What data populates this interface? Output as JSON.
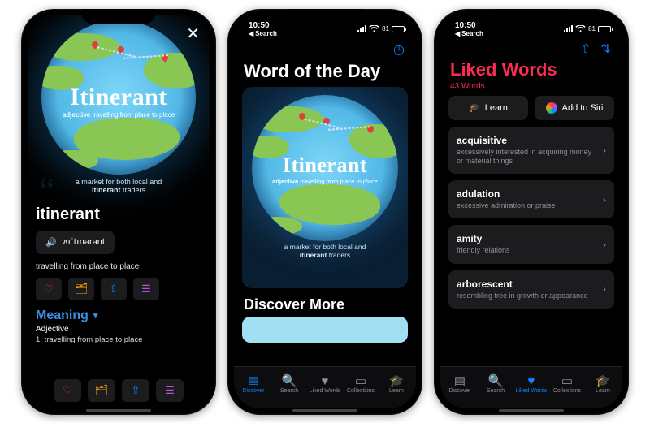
{
  "statusbar": {
    "time": "10:50",
    "battery_pct": "81",
    "back_label": "Search",
    "wifi_icon": "wifi-icon"
  },
  "word_card": {
    "word_display": "Itinerant",
    "pos": "adjective",
    "tagline": "travelling from place to place",
    "quote_prefix": "a market for both local and",
    "quote_bold": "itinerant",
    "quote_suffix": "traders"
  },
  "screen1": {
    "close_glyph": "✕",
    "word": "itinerant",
    "pron_glyph": "🔊",
    "pronunciation": "ʌɪˈtɪnərənt",
    "short_def": "travelling from place to place",
    "actions": {
      "like_glyph": "♡",
      "like_color": "#ff2d55",
      "collect_glyph": "🗂",
      "collect_color": "#ff9f0a",
      "share_glyph": "⇧",
      "share_color": "#0a84ff",
      "notes_glyph": "☰",
      "notes_color": "#af52de"
    },
    "section_meaning": "Meaning",
    "section_chevron": "▾",
    "pos_label": "Adjective",
    "def1": "1. travelling from place to place"
  },
  "screen2": {
    "clock_glyph": "◷",
    "title": "Word of the Day",
    "discover": "Discover More"
  },
  "screen3": {
    "share_glyph": "⇧",
    "sort_glyph": "⇅",
    "title": "Liked Words",
    "count": "43 Words",
    "learn_btn": {
      "glyph": "🎓",
      "label": "Learn"
    },
    "siri_btn": {
      "label": "Add to Siri"
    },
    "items": [
      {
        "word": "acquisitive",
        "def": "excessively interested in acquiring money or material things"
      },
      {
        "word": "adulation",
        "def": "excessive admiration or praise"
      },
      {
        "word": "amity",
        "def": "friendly relations"
      },
      {
        "word": "arborescent",
        "def": "resembling tree in growth or appearance"
      }
    ]
  },
  "tabs": [
    {
      "key": "discover",
      "label": "Discover",
      "glyph": "▤"
    },
    {
      "key": "search",
      "label": "Search",
      "glyph": "🔍"
    },
    {
      "key": "liked",
      "label": "Liked Words",
      "glyph": "♥"
    },
    {
      "key": "collections",
      "label": "Collections",
      "glyph": "▭"
    },
    {
      "key": "learn",
      "label": "Learn",
      "glyph": "🎓"
    }
  ]
}
